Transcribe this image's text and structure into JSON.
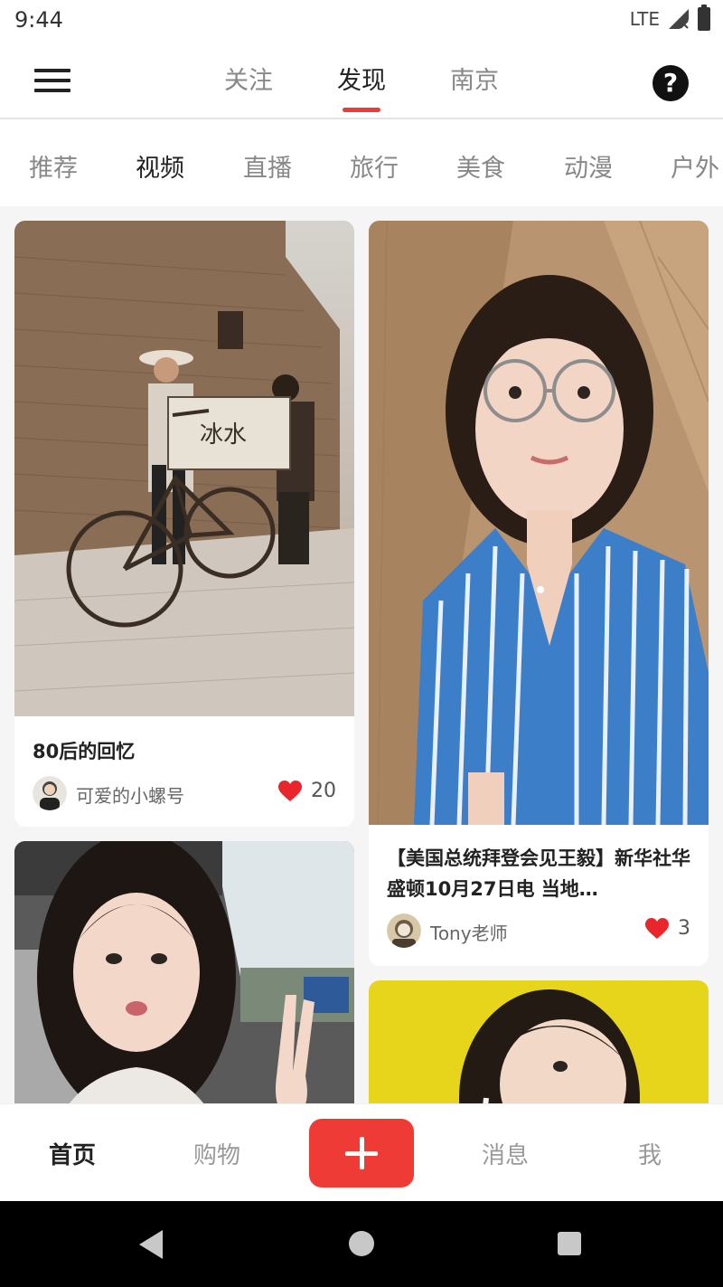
{
  "status_bar": {
    "time": "9:44",
    "network": "LTE"
  },
  "top_nav": {
    "tabs": [
      {
        "label": "关注"
      },
      {
        "label": "发现"
      },
      {
        "label": "南京"
      }
    ],
    "active_tab": "发现",
    "help_icon": "?"
  },
  "categories": [
    "推荐",
    "视频",
    "直播",
    "旅行",
    "美食",
    "动漫",
    "户外"
  ],
  "active_category": "视频",
  "feed": {
    "cards": [
      {
        "title": "80后的回忆",
        "author": "可爱的小螺号",
        "likes": "20",
        "image": "bicycle-photo"
      },
      {
        "title": "【美国总统拜登会见王毅】新华社华盛顿10月27日电 当地…",
        "author": "Tony老师",
        "likes": "3",
        "image": "woman-striped-shirt-photo"
      },
      {
        "title": "",
        "author": "",
        "likes": "",
        "image": "woman-in-car-photo"
      },
      {
        "title": "",
        "author": "",
        "likes": "",
        "image": "woman-yellow-background-photo"
      }
    ]
  },
  "bottom_nav": {
    "items": [
      {
        "label": "首页"
      },
      {
        "label": "购物"
      },
      {
        "label": "消息"
      },
      {
        "label": "我"
      }
    ],
    "active": "首页"
  },
  "colors": {
    "accent": "#ef3b35",
    "heart": "#e8262c",
    "background": "#f5f5f5"
  }
}
